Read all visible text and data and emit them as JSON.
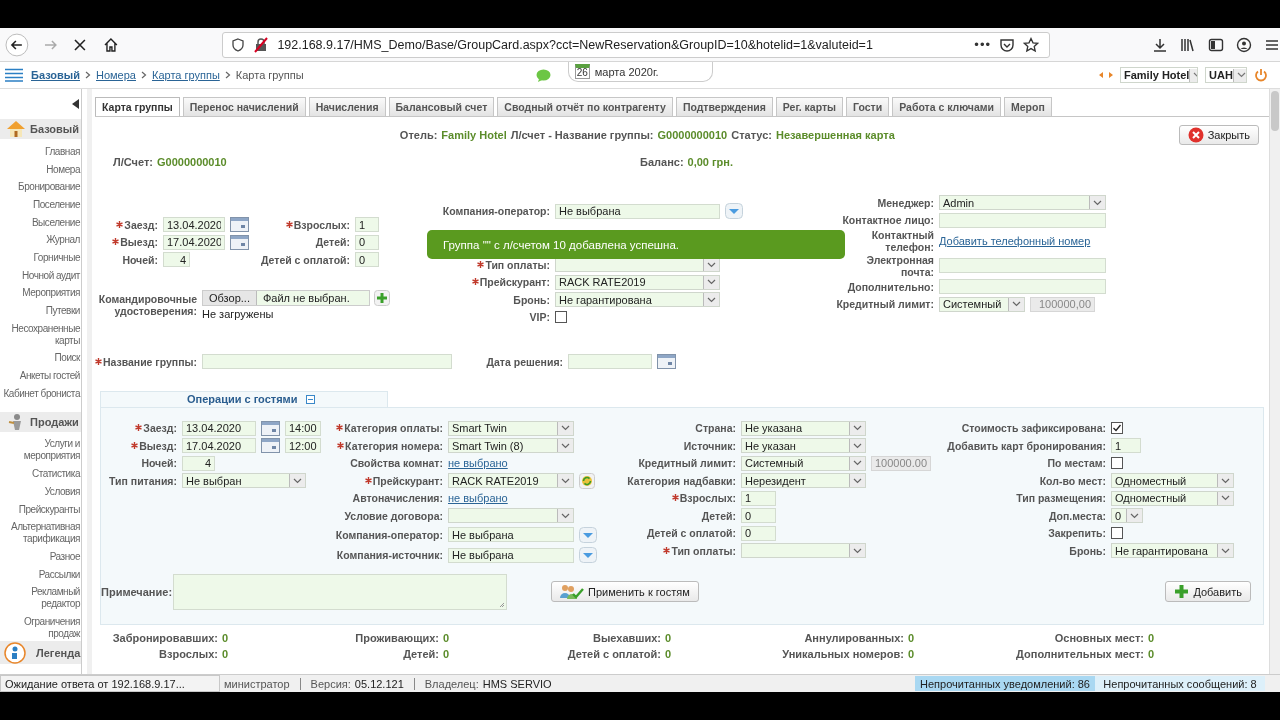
{
  "browser": {
    "url": "192.168.9.17/HMS_Demo/Base/GroupCard.aspx?cct=NewReservation&GroupID=10&hotelid=1&valuteid=1",
    "more": "•••",
    "status": "Ожидание ответа от 192.168.9.17..."
  },
  "header": {
    "breadcrumbs": [
      {
        "label": "Базовый",
        "link": true
      },
      {
        "label": "Номера",
        "link": true
      },
      {
        "label": "Карта группы",
        "link": true
      },
      {
        "label": "Карта группы",
        "link": false
      }
    ],
    "date_day": "26",
    "date_text": "марта 2020г.",
    "hotel": "Family Hotel",
    "currency": "UAH"
  },
  "sidebar": {
    "sections": [
      {
        "title": "Базовый",
        "items": [
          "Главная",
          "Номера",
          "Бронирование",
          "Поселение",
          "Выселение",
          "Журнал",
          "Горничные",
          "Ночной аудит",
          "Мероприятия",
          "Путевки",
          "Несохраненные карты",
          "Поиск",
          "Анкеты гостей",
          "Кабинет брониста"
        ]
      },
      {
        "title": "Продажи",
        "items": [
          "Услуги и мероприятия",
          "Статистика",
          "Условия",
          "Прейскуранты",
          "Альтернативная тарификация",
          "Разное",
          "Рассылки",
          "Рекламный редактор",
          "Ограничения продаж"
        ]
      }
    ],
    "legend": "Легенда"
  },
  "tabs": [
    {
      "label": "Карта группы",
      "selected": true
    },
    {
      "label": "Перенос начислений",
      "selected": false
    },
    {
      "label": "Начисления",
      "selected": false
    },
    {
      "label": "Балансовый счет",
      "selected": false
    },
    {
      "label": "Сводный отчёт по контрагенту",
      "selected": false
    },
    {
      "label": "Подтверждения",
      "selected": false
    },
    {
      "label": "Рег. карты",
      "selected": false
    },
    {
      "label": "Гости",
      "selected": false
    },
    {
      "label": "Работа с ключами",
      "selected": false
    },
    {
      "label": "Мероп",
      "selected": false
    }
  ],
  "card": {
    "info": [
      {
        "label": "Отель:",
        "value": "Family Hotel"
      },
      {
        "label": "Л/счет - Название группы:",
        "value": "G0000000010"
      },
      {
        "label": "Статус:",
        "value": "Незавершенная карта"
      }
    ],
    "close": "Закрыть",
    "account": {
      "label": "Л/Счет:",
      "value": "G0000000010"
    },
    "balance": {
      "label": "Баланс:",
      "value": "0,00 грн."
    }
  },
  "toast": "Группа \"\" с л/счетом 10 добавлена успешна.",
  "forms": [
    {
      "blocks": [
        [
          {
            "label": "Заезд:",
            "required": true,
            "kind": "date",
            "value": "13.04.2020"
          },
          {
            "label": "Выезд:",
            "required": true,
            "kind": "date",
            "value": "17.04.2020"
          },
          {
            "label": "Ночей:",
            "required": false,
            "kind": "number",
            "value": "4"
          }
        ],
        [
          {
            "label": "Взрослых:",
            "required": true,
            "kind": "short",
            "value": "1"
          },
          {
            "label": "Детей:",
            "required": false,
            "kind": "short",
            "value": "0"
          },
          {
            "label": "Детей с оплатой:",
            "required": false,
            "kind": "short",
            "value": "0"
          }
        ],
        [
          {
            "label": "Компания-оператор:",
            "required": false,
            "kind": "lookup",
            "value": "Не выбрана"
          },
          {
            "label": "Тип оплаты:",
            "required": true,
            "kind": "select"
          },
          {
            "label": "Прейскурант:",
            "required": true,
            "kind": "select",
            "value": "RACK RATE2019"
          },
          {
            "label": "Бронь:",
            "required": false,
            "kind": "select",
            "value": "Не гарантирована"
          },
          {
            "label": "VIP:",
            "required": false,
            "kind": "checkbox",
            "checked": false
          }
        ],
        [
          {
            "label": "Менеджер:",
            "required": false,
            "kind": "select",
            "value": "Admin"
          },
          {
            "label": "Контактное лицо:",
            "required": false,
            "kind": "input"
          },
          {
            "label": "Контактный телефон:",
            "required": false,
            "kind": "link",
            "value": "Добавить телефонный номер"
          },
          {
            "label": "Электронная почта:",
            "required": false,
            "kind": "input"
          },
          {
            "label": "Дополнительно:",
            "required": false,
            "kind": "input"
          },
          {
            "label": "Кредитный лимит:",
            "required": false,
            "kind": "limit",
            "value": "Системный",
            "amount": "100000,00"
          }
        ],
        [
          {
            "label": "Командировочные удостоверения:",
            "required": false,
            "kind": "file",
            "button": "Обзор...",
            "value": "Файл не выбран.",
            "note": "Не загружены"
          }
        ],
        [
          {
            "label": "Название группы:",
            "required": true,
            "kind": "input"
          }
        ],
        [
          {
            "label": "Дата решения:",
            "required": false,
            "kind": "date"
          }
        ]
      ]
    },
    {
      "title": "Операции с гостями",
      "expanded": true,
      "blocks": [
        [
          {
            "label": "Заезд:",
            "required": true,
            "kind": "datetime",
            "value": "13.04.2020",
            "time": "14:00"
          },
          {
            "label": "Выезд:",
            "required": true,
            "kind": "datetime",
            "value": "17.04.2020",
            "time": "12:00"
          },
          {
            "label": "Ночей:",
            "required": false,
            "kind": "number",
            "value": "4"
          },
          {
            "label": "Тип питания:",
            "required": false,
            "kind": "select",
            "value": "Не выбран"
          }
        ],
        [
          {
            "label": "Категория оплаты:",
            "required": true,
            "kind": "select",
            "value": "Smart Twin"
          },
          {
            "label": "Категория номера:",
            "required": true,
            "kind": "select",
            "value": "Smart Twin (8)"
          },
          {
            "label": "Свойства комнат:",
            "required": false,
            "kind": "link",
            "value": "не выбрано"
          },
          {
            "label": "Прейскурант:",
            "required": true,
            "kind": "select_refresh",
            "value": "RACK RATE2019"
          },
          {
            "label": "Автоначисления:",
            "required": false,
            "kind": "link",
            "value": "не выбрано"
          },
          {
            "label": "Условие договора:",
            "required": false,
            "kind": "select"
          },
          {
            "label": "Компания-оператор:",
            "required": false,
            "kind": "lookup",
            "value": "Не выбрана"
          },
          {
            "label": "Компания-источник:",
            "required": false,
            "kind": "lookup",
            "value": "Не выбрана"
          }
        ],
        [
          {
            "label": "Страна:",
            "required": false,
            "kind": "select",
            "value": "Не указана"
          },
          {
            "label": "Источник:",
            "required": false,
            "kind": "select",
            "value": "Не указан"
          },
          {
            "label": "Кредитный лимит:",
            "required": false,
            "kind": "limit",
            "value": "Системный",
            "amount": "100000.00"
          },
          {
            "label": "Категория надбавки:",
            "required": false,
            "kind": "select",
            "value": "Нерезидент"
          },
          {
            "label": "Взрослых:",
            "required": true,
            "kind": "short",
            "value": "1"
          },
          {
            "label": "Детей:",
            "required": false,
            "kind": "short",
            "value": "0"
          },
          {
            "label": "Детей с оплатой:",
            "required": false,
            "kind": "short",
            "value": "0"
          },
          {
            "label": "Тип оплаты:",
            "required": true,
            "kind": "select"
          }
        ],
        [
          {
            "label": "Стоимость зафиксирована:",
            "required": false,
            "kind": "checkbox",
            "checked": true
          },
          {
            "label": "Добавить карт бронирования:",
            "required": false,
            "kind": "short",
            "value": "1"
          },
          {
            "label": "По местам:",
            "required": false,
            "kind": "checkbox",
            "checked": false
          },
          {
            "label": "Кол-во мест:",
            "required": false,
            "kind": "select",
            "value": "Одноместный"
          },
          {
            "label": "Тип размещения:",
            "required": false,
            "kind": "select",
            "value": "Одноместный"
          },
          {
            "label": "Доп.места:",
            "required": false,
            "kind": "small_select",
            "value": "0"
          },
          {
            "label": "Закрепить:",
            "required": false,
            "kind": "checkbox",
            "checked": false
          },
          {
            "label": "Бронь:",
            "required": false,
            "kind": "select",
            "value": "Не гарантирована"
          }
        ]
      ],
      "note": {
        "label": "Примечание:"
      },
      "apply": "Применить к гостям",
      "add": "Добавить"
    }
  ],
  "stats": [
    [
      {
        "label": "Забронировавших:",
        "value": "0"
      },
      {
        "label": "Взрослых:",
        "value": "0"
      }
    ],
    [
      {
        "label": "Проживающих:",
        "value": "0"
      },
      {
        "label": "Детей:",
        "value": "0"
      }
    ],
    [
      {
        "label": "Выехавших:",
        "value": "0"
      },
      {
        "label": "Детей с оплатой:",
        "value": "0"
      }
    ],
    [
      {
        "label": "Аннулированных:",
        "value": "0"
      },
      {
        "label": "Уникальных номеров:",
        "value": "0"
      }
    ],
    [
      {
        "label": "Основных мест:",
        "value": "0"
      },
      {
        "label": "Дополнительных мест:",
        "value": "0"
      }
    ]
  ],
  "status_bar": {
    "user": "министратор",
    "version_label": "Версия:",
    "version": "05.12.121",
    "owner_label": "Владелец:",
    "owner": "HMS SERVIO",
    "notifications": "Непрочитанных уведомлений: 86",
    "messages": "Непрочитанных сообщений: 8"
  }
}
